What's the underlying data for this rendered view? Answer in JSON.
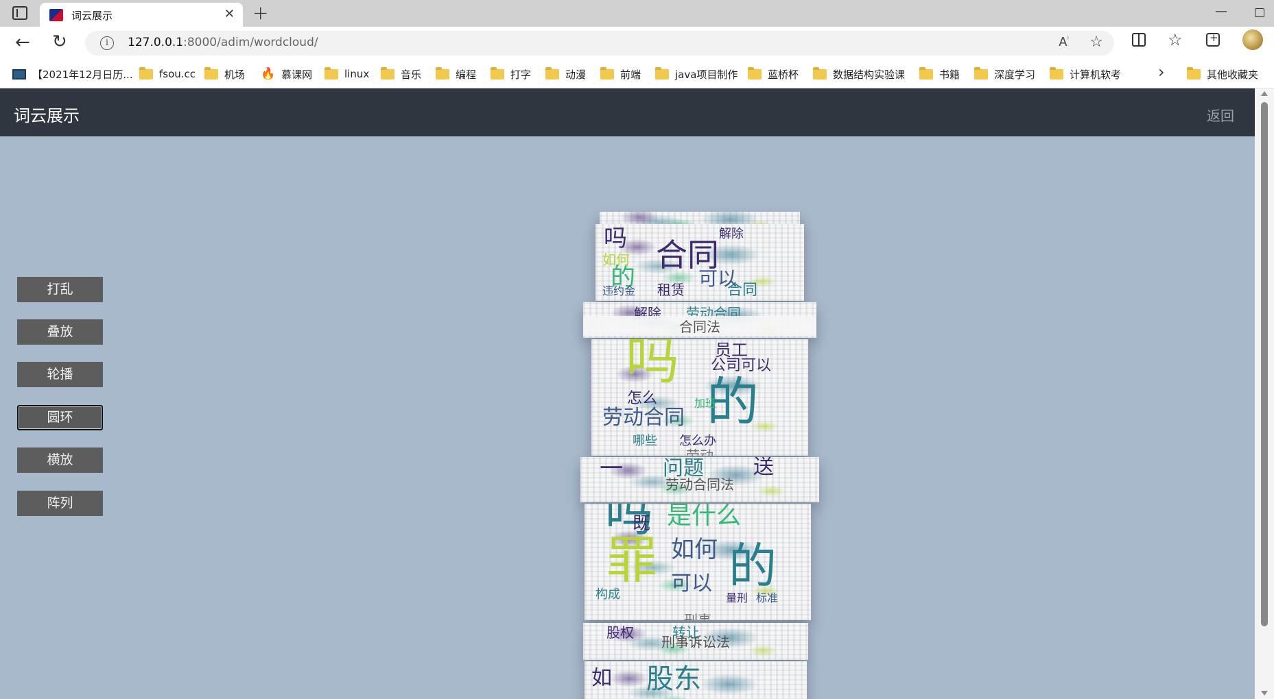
{
  "browser": {
    "tab_title": "词云展示",
    "url_host": "127.0.0.1",
    "url_path": ":8000/adim/wordcloud/",
    "bookmarks": [
      "【2021年12月日历...",
      "fsou.cc",
      "机场",
      "慕课网",
      "linux",
      "音乐",
      "编程",
      "打字",
      "动漫",
      "前端",
      "java项目制作",
      "蓝桥杯",
      "数据结构实验课",
      "书籍",
      "深度学习",
      "计算机软考",
      "其他收藏夹"
    ]
  },
  "header": {
    "title": "词云展示",
    "back_label": "返回"
  },
  "controls": {
    "buttons": [
      {
        "label": "打乱",
        "active": false
      },
      {
        "label": "叠放",
        "active": false
      },
      {
        "label": "轮播",
        "active": false
      },
      {
        "label": "圆环",
        "active": true
      },
      {
        "label": "横放",
        "active": false
      },
      {
        "label": "阵列",
        "active": false
      }
    ]
  },
  "cards": {
    "labels": [
      "合同法",
      "劳动合同法",
      "刑事",
      "刑事诉讼法"
    ],
    "partial_labels": [
      "劳动"
    ]
  },
  "colors": {
    "header_bg": "#2f3640",
    "page_bg": "#a8b9cb",
    "button_bg": "#5d5d5d"
  }
}
